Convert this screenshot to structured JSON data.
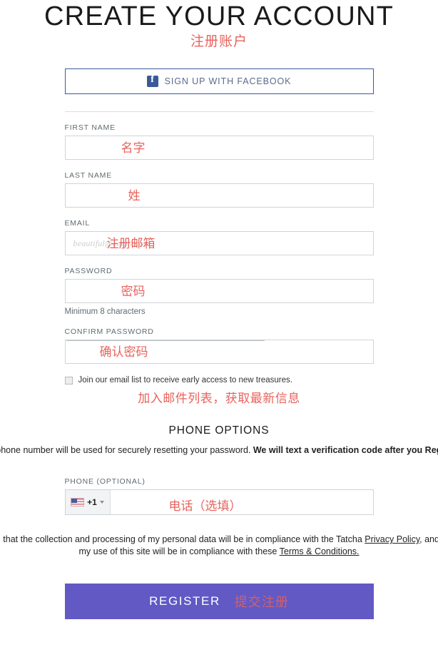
{
  "header": {
    "title": "CREATE YOUR ACCOUNT",
    "title_cn": "注册账户"
  },
  "social": {
    "facebook_label": "SIGN UP WITH FACEBOOK",
    "facebook_icon": "facebook-icon"
  },
  "fields": {
    "first_name": {
      "label": "FIRST NAME",
      "value": "",
      "annotation_cn": "名字"
    },
    "last_name": {
      "label": "LAST NAME",
      "value": "",
      "annotation_cn": "姓"
    },
    "email": {
      "label": "EMAIL",
      "value": "",
      "placeholder": "beautiful@email.com",
      "annotation_cn": "注册邮箱"
    },
    "password": {
      "label": "PASSWORD",
      "value": "",
      "hint": "Minimum 8 characters",
      "annotation_cn": "密码"
    },
    "confirm_password": {
      "label": "CONFIRM PASSWORD",
      "value": "",
      "annotation_cn": "确认密码"
    },
    "phone": {
      "label": "PHONE (OPTIONAL)",
      "value": "",
      "country_code": "+1",
      "country_flag": "us-flag-icon",
      "annotation_cn": "电话（选填）"
    }
  },
  "newsletter": {
    "checkbox_label": "Join our email list to receive early access to new treasures.",
    "checked": false,
    "annotation_cn": "加入邮件列表，获取最新信息"
  },
  "phone_section": {
    "heading": "PHONE OPTIONS",
    "description_part1": "Your phone number will be used for securely resetting your password. ",
    "description_bold": "We will text a verification code after you Register."
  },
  "legal": {
    "text_part1": "I understand that the collection and processing of my personal data will be in compliance with the Tatcha ",
    "privacy_policy": "Privacy Policy",
    "text_part2": ", and I agree that my use of this site will be in compliance with these ",
    "terms": "Terms & Conditions."
  },
  "submit": {
    "label": "REGISTER",
    "annotation_cn": "提交注册",
    "color": "#6259c5"
  }
}
